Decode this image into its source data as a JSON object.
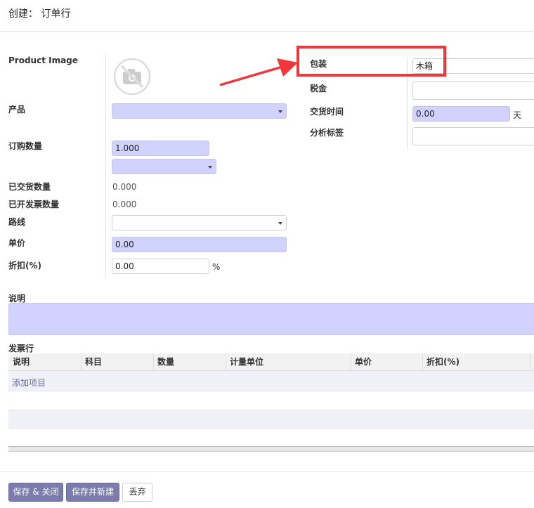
{
  "header": {
    "title": "创建： 订单行"
  },
  "form": {
    "product_image_label": "Product Image",
    "product_label": "产品",
    "product_value": "",
    "qty_label": "订购数量",
    "qty_value": "1.000",
    "uom_value": "",
    "delivered_label": "已交货数量",
    "delivered_value": "0.000",
    "invoiced_label": "已开发票数量",
    "invoiced_value": "0.000",
    "route_label": "路线",
    "route_value": "",
    "unit_price_label": "单价",
    "unit_price_value": "0.00",
    "discount_label": "折扣(%)",
    "discount_value": "0.00",
    "discount_unit": "%",
    "packaging_label": "包装",
    "packaging_value": "木箱",
    "tax_label": "税金",
    "tax_value": "",
    "lead_time_label": "交货时间",
    "lead_time_value": "0.00",
    "lead_time_unit": "天",
    "analytic_tags_label": "分析标签",
    "analytic_tags_value": "",
    "description_label": "说明",
    "description_value": ""
  },
  "invoice_lines": {
    "section_label": "发票行",
    "columns": [
      "说明",
      "科目",
      "数量",
      "计量单位",
      "单价",
      "折扣(%)"
    ],
    "add_item": "添加项目"
  },
  "footer": {
    "save_close": "保存 & 关闭",
    "save_new": "保存并新建",
    "discard": "丢弃"
  },
  "colors": {
    "primary": "#7c7bad",
    "required_field": "#d2d2ff",
    "annotation_red": "#f0383c"
  }
}
